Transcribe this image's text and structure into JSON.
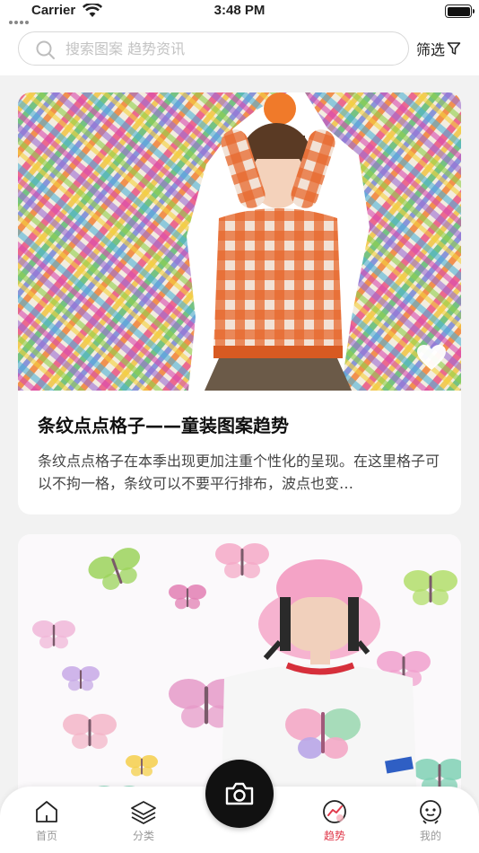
{
  "status_bar": {
    "carrier": "Carrier",
    "time": "3:48 PM"
  },
  "search": {
    "placeholder": "搜索图案 趋势资讯"
  },
  "filter": {
    "label": "筛选"
  },
  "articles": [
    {
      "title": "条纹点点格子——童装图案趋势",
      "description": "条纹点点格子在本季出现更加注重个性化的呈现。在这里格子可以不拘一格，条纹可以不要平行排布，波点也变…",
      "image": "girl-in-orange-gingham-sweater-on-crayon-plaid"
    },
    {
      "title": "",
      "description": "",
      "image": "girl-in-bucket-hat-on-watercolor-butterflies"
    }
  ],
  "tabs": [
    {
      "label": "首页",
      "icon": "home-icon",
      "active": false
    },
    {
      "label": "分类",
      "icon": "layers-icon",
      "active": false
    },
    {
      "label": "趋势",
      "icon": "trend-icon",
      "active": true
    },
    {
      "label": "我的",
      "icon": "profile-icon",
      "active": false
    }
  ],
  "camera": {
    "icon": "camera-icon"
  },
  "colors": {
    "accent": "#e0394b",
    "tab_inactive": "#999999",
    "camera_bg": "#111111"
  }
}
